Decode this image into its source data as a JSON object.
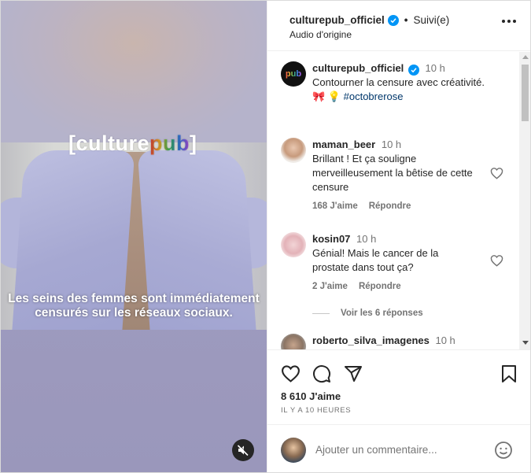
{
  "video": {
    "logo_prefix": "[culture",
    "logo_brand": "pub",
    "logo_suffix": "]",
    "caption_line1": "Les seins des femmes sont immédiatement",
    "caption_line2": "censurés sur les réseaux sociaux.",
    "mute_icon": "volume-mute-icon"
  },
  "header": {
    "username": "culturepub_officiel",
    "separator": "•",
    "follow_status": "Suivi(e)",
    "audio": "Audio d'origine",
    "more_icon": "more-horizontal-icon"
  },
  "post": {
    "username": "culturepub_officiel",
    "time": "10 h",
    "avatar_text": "pub",
    "text_line1": "Contourner la censure avec créativité.",
    "emojis": "🎀 💡",
    "hashtag": "#octobrerose"
  },
  "comments": [
    {
      "username": "maman_beer",
      "time": "10 h",
      "lines": [
        "Brillant ! Et ça souligne",
        "merveilleusement la bêtise de cette",
        "censure"
      ],
      "likes": "168 J'aime",
      "reply": "Répondre"
    },
    {
      "username": "kosin07",
      "time": "10 h",
      "lines": [
        "Génial! Mais le cancer de la",
        "prostate dans tout ça?"
      ],
      "likes": "2 J'aime",
      "reply": "Répondre",
      "view_replies": "Voir les 6 réponses"
    },
    {
      "username": "roberto_silva_imagenes",
      "time": "10 h"
    }
  ],
  "actions": {
    "likes": "8 610 J'aime",
    "ago": "IL Y A 10 HEURES"
  },
  "comment_box": {
    "placeholder": "Ajouter un commentaire..."
  },
  "colors": {
    "verified": "#0095f6",
    "hashtag": "#00376b",
    "muted_text": "#737373"
  }
}
